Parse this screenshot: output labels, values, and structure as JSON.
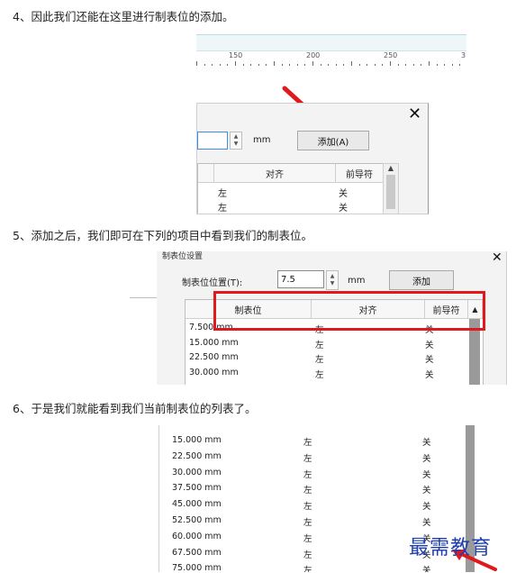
{
  "steps": {
    "s4": "4、因此我们还能在这里进行制表位的添加。",
    "s5": "5、添加之后，我们即可在下列的项目中看到我们的制表位。",
    "s6": "6、于是我们就能看到我们当前制表位的列表了。"
  },
  "ruler": {
    "labels": [
      "150",
      "200",
      "250",
      "3"
    ]
  },
  "dialog1": {
    "unit": "mm",
    "add_button": "添加(A)",
    "headers": [
      "对齐",
      "前导符"
    ],
    "rows": [
      [
        "左",
        "关"
      ],
      [
        "左",
        "关"
      ]
    ]
  },
  "dialog2": {
    "group_label": "制表位设置",
    "position_label": "制表位位置(T):",
    "position_value": "7.5",
    "unit": "mm",
    "add_button": "添加",
    "headers": [
      "制表位",
      "对齐",
      "前导符"
    ],
    "rows": [
      [
        "7.500 mm",
        "左",
        "关"
      ],
      [
        "15.000 mm",
        "左",
        "关"
      ],
      [
        "22.500 mm",
        "左",
        "关"
      ],
      [
        "30.000 mm",
        "左",
        "关"
      ]
    ]
  },
  "list6": {
    "rows": [
      [
        "15.000 mm",
        "左",
        "关"
      ],
      [
        "22.500 mm",
        "左",
        "关"
      ],
      [
        "30.000 mm",
        "左",
        "关"
      ],
      [
        "37.500 mm",
        "左",
        "关"
      ],
      [
        "45.000 mm",
        "左",
        "关"
      ],
      [
        "52.500 mm",
        "左",
        "关"
      ],
      [
        "60.000 mm",
        "左",
        "关"
      ],
      [
        "67.500 mm",
        "左",
        "关"
      ],
      [
        "75.000 mm",
        "左",
        "关"
      ]
    ]
  },
  "watermark": "最需教育",
  "colors": {
    "annotation_red": "#e0191c",
    "watermark_blue": "#1f3fb0"
  }
}
